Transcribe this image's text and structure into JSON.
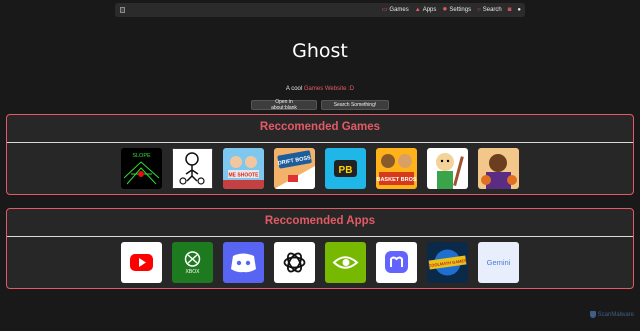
{
  "nav": {
    "links": [
      {
        "label": "Games",
        "icon": "gamepad-icon"
      },
      {
        "label": "Apps",
        "icon": "apps-icon"
      },
      {
        "label": "Settings",
        "icon": "gear-icon"
      },
      {
        "label": "Search",
        "icon": "search-icon"
      }
    ],
    "extra_icons": [
      "discord-icon",
      "github-icon"
    ]
  },
  "hero": {
    "title": "Ghost",
    "tagline_prefix": "A cool ",
    "tagline_accent": "Games Website :D",
    "buttons": [
      "Open in about:blank",
      "Search Something!"
    ]
  },
  "games": {
    "heading": "Reccomended Games",
    "tiles": [
      {
        "name": "slope",
        "text": "SLOPE"
      },
      {
        "name": "stickman",
        "text": ""
      },
      {
        "name": "shooter",
        "text": "ME SHOOTE"
      },
      {
        "name": "drift-boss",
        "text": "DRIFT BOSS"
      },
      {
        "name": "pb",
        "text": "PB"
      },
      {
        "name": "basket-bros",
        "text": "BASKET BROS"
      },
      {
        "name": "baldi",
        "text": ""
      },
      {
        "name": "basketball-player",
        "text": ""
      }
    ]
  },
  "apps": {
    "heading": "Reccomended Apps",
    "tiles": [
      {
        "name": "youtube",
        "text": ""
      },
      {
        "name": "xbox",
        "text": "XBOX"
      },
      {
        "name": "discord",
        "text": ""
      },
      {
        "name": "chatgpt",
        "text": ""
      },
      {
        "name": "nvidia",
        "text": ""
      },
      {
        "name": "mastodon",
        "text": ""
      },
      {
        "name": "coolmath-games",
        "text": "COOLMATH GAMES"
      },
      {
        "name": "gemini",
        "text": "Gemini"
      }
    ]
  },
  "watermark": "ScanMalware",
  "colors": {
    "accent": "#e35a66",
    "background": "#191919",
    "panel": "#272727"
  }
}
